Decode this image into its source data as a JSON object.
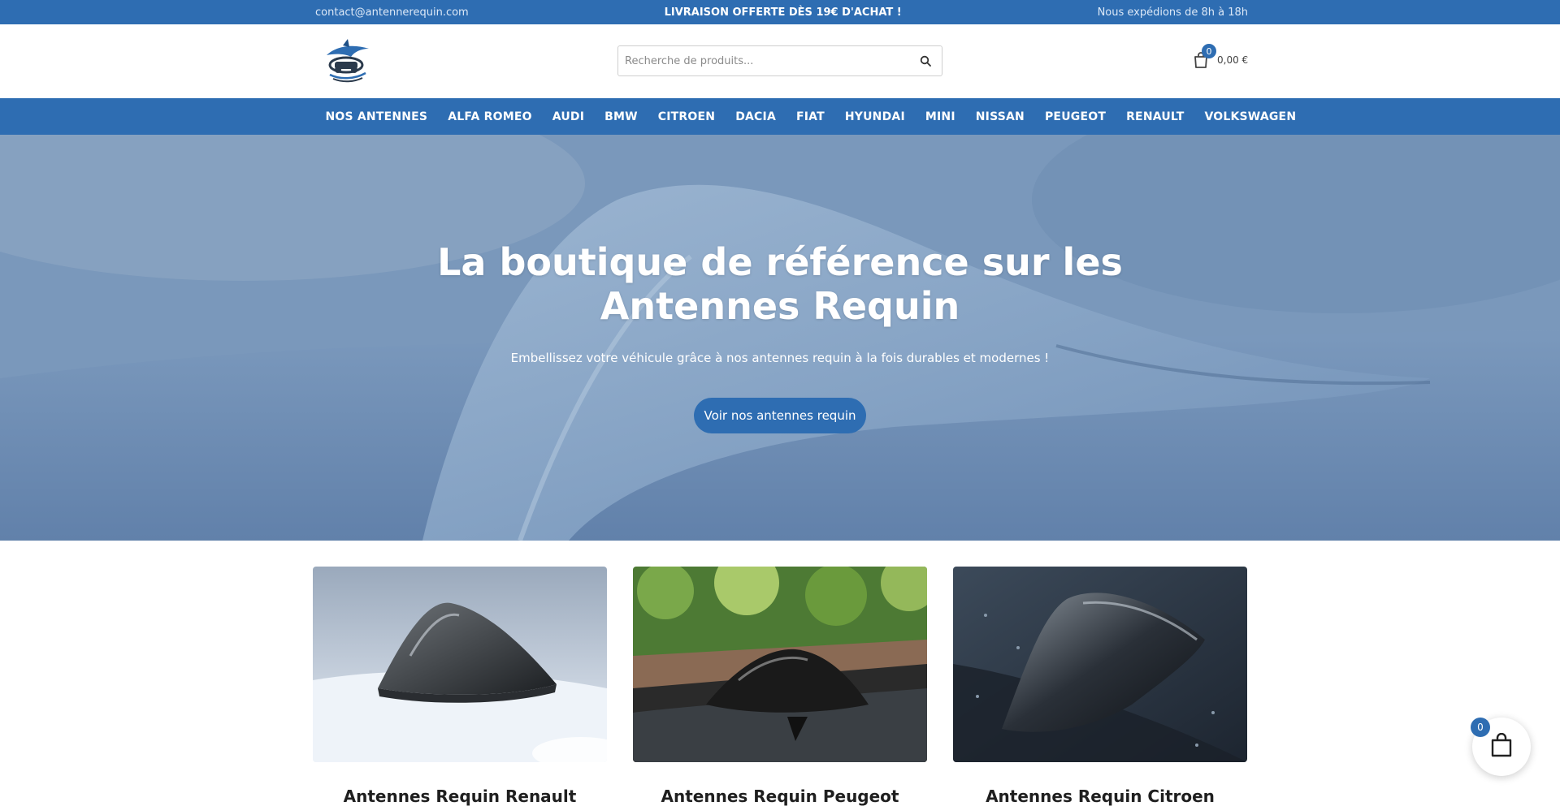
{
  "topbar": {
    "email": "contact@antennerequin.com",
    "promo": "LIVRAISON OFFERTE DÈS 19€ D'ACHAT !",
    "hours": "Nous expédions de 8h à 18h"
  },
  "header": {
    "search_placeholder": "Recherche de produits...",
    "cart_count": "0",
    "cart_total": "0,00 €"
  },
  "nav": {
    "items": [
      "NOS ANTENNES",
      "ALFA ROMEO",
      "AUDI",
      "BMW",
      "CITROEN",
      "DACIA",
      "FIAT",
      "HYUNDAI",
      "MINI",
      "NISSAN",
      "PEUGEOT",
      "RENAULT",
      "VOLKSWAGEN"
    ]
  },
  "hero": {
    "title": "La boutique de référence sur les Antennes Requin",
    "subtitle": "Embellissez votre véhicule grâce à nos antennes requin à la fois durables et modernes !",
    "cta": "Voir nos antennes requin"
  },
  "categories": [
    {
      "title": "Antennes Requin Renault"
    },
    {
      "title": "Antennes Requin Peugeot"
    },
    {
      "title": "Antennes Requin Citroen"
    }
  ],
  "floating_cart": {
    "count": "0"
  },
  "colors": {
    "brand": "#2e6db2"
  }
}
